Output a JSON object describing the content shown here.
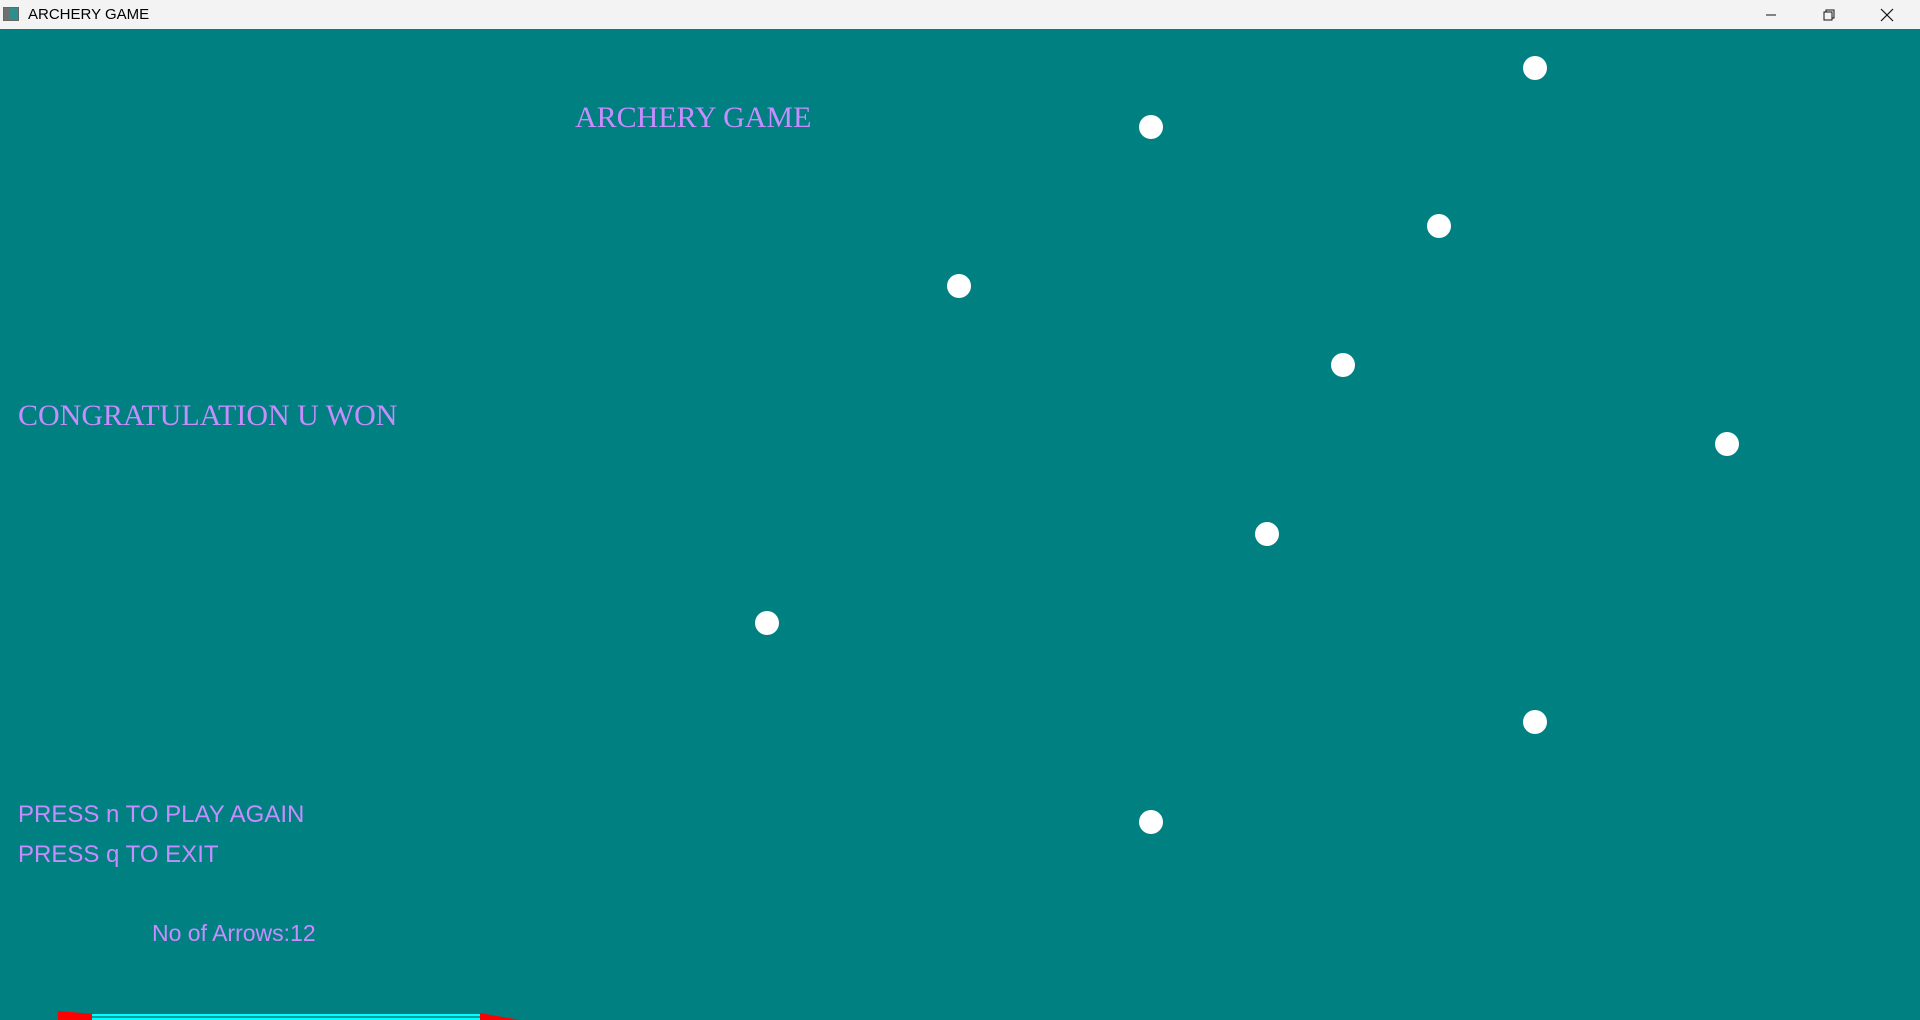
{
  "window": {
    "title": "ARCHERY GAME",
    "buttons": {
      "minimize_icon": "minimize-icon",
      "maximize_icon": "restore-icon",
      "close_icon": "close-icon"
    }
  },
  "game": {
    "title": "ARCHERY GAME",
    "win_message": "CONGRATULATION U WON",
    "instructions": {
      "play_again": "PRESS n TO PLAY AGAIN",
      "exit": "PRESS q TO EXIT"
    },
    "arrows_label": "No of Arrows:12",
    "targets_count": 10,
    "colors": {
      "background": "#008080",
      "text": "#c78cff",
      "target": "#ffffff",
      "arrow_shaft": "#00ffff",
      "arrow_tip": "#ff0000"
    }
  }
}
